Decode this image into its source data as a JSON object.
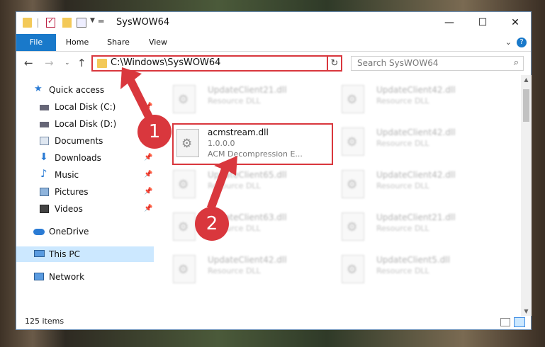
{
  "window": {
    "title": "SysWOW64",
    "controls": {
      "minimize": "—",
      "maximize": "☐",
      "close": "✕"
    }
  },
  "ribbon": {
    "tabs": [
      "File",
      "Home",
      "Share",
      "View"
    ],
    "expand": "⌄",
    "help": "?"
  },
  "nav": {
    "back": "←",
    "forward": "→",
    "recent": "⌄",
    "up": "↑",
    "address": "C:\\Windows\\SysWOW64",
    "address_dropdown": "⌄",
    "refresh": "↻",
    "search_placeholder": "Search SysWOW64",
    "search_icon": "⌕"
  },
  "sidebar": {
    "items": [
      {
        "label": "Quick access",
        "icon": "star-icon",
        "pinned": false
      },
      {
        "label": "Local Disk (C:)",
        "icon": "drive-icon",
        "pinned": true
      },
      {
        "label": "Local Disk (D:)",
        "icon": "drive-icon",
        "pinned": true
      },
      {
        "label": "Documents",
        "icon": "documents-icon",
        "pinned": true
      },
      {
        "label": "Downloads",
        "icon": "download-icon",
        "pinned": true
      },
      {
        "label": "Music",
        "icon": "music-icon",
        "pinned": true
      },
      {
        "label": "Pictures",
        "icon": "pictures-icon",
        "pinned": true
      },
      {
        "label": "Videos",
        "icon": "videos-icon",
        "pinned": true
      },
      {
        "label": "OneDrive",
        "icon": "cloud-icon",
        "pinned": false
      },
      {
        "label": "This PC",
        "icon": "computer-icon",
        "pinned": false,
        "selected": true
      },
      {
        "label": "Network",
        "icon": "network-icon",
        "pinned": false
      }
    ],
    "pin_glyph": "📌"
  },
  "files": {
    "selected": {
      "name": "acmstream.dll",
      "version": "1.0.0.0",
      "description": "ACM Decompression E..."
    },
    "background": [
      {
        "name": "UpdateClient21.dll",
        "type": "Resource DLL"
      },
      {
        "name": "UpdateClient42.dll",
        "type": "Resource DLL"
      },
      {
        "name": "UpdateClient42.dll",
        "type": "Resource DLL"
      },
      {
        "name": "UpdateClient65.dll",
        "type": "Resource DLL"
      },
      {
        "name": "UpdateClient42.dll",
        "type": "Resource DLL"
      },
      {
        "name": "UpdateClient63.dll",
        "type": "Resource DLL"
      },
      {
        "name": "UpdateClient21.dll",
        "type": "Resource DLL"
      },
      {
        "name": "UpdateClient42.dll",
        "type": "Resource DLL"
      },
      {
        "name": "UpdateClient5.dll",
        "type": "Resource DLL"
      }
    ]
  },
  "status": {
    "items_count": "125 items"
  },
  "annotations": {
    "step1": "1",
    "step2": "2"
  },
  "colors": {
    "accent": "#1979ca",
    "highlight": "#d9373d",
    "selection": "#cce8ff"
  }
}
